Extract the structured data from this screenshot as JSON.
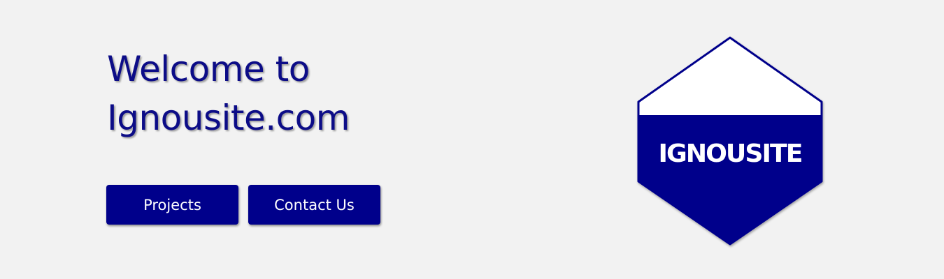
{
  "hero": {
    "title_line1": "Welcome to",
    "title_line2": "Ignousite.com"
  },
  "buttons": {
    "projects_label": "Projects",
    "contact_label": "Contact Us"
  },
  "logo": {
    "text": "IGNOUSITE",
    "icon": "hexagon-logo"
  },
  "colors": {
    "brand": "#00008b",
    "background": "#f2f2f2",
    "title": "#0c0c87"
  }
}
